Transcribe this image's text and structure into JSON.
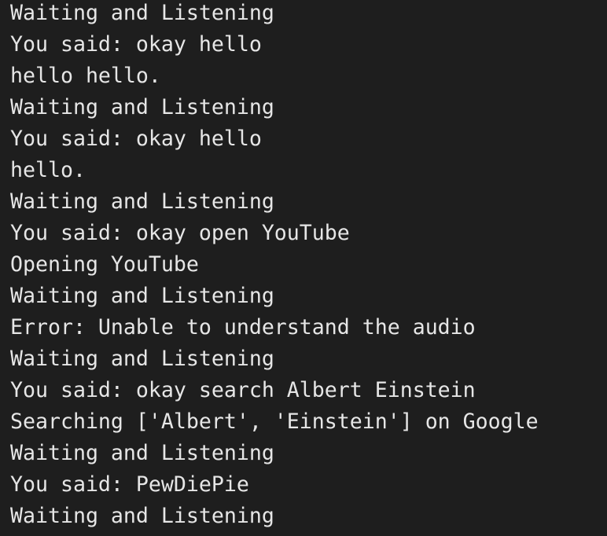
{
  "terminal": {
    "lines": [
      "Waiting and Listening",
      "You said: okay hello",
      "hello hello.",
      "Waiting and Listening",
      "You said: okay hello",
      "hello.",
      "Waiting and Listening",
      "You said: okay open YouTube",
      "Opening YouTube",
      "Waiting and Listening",
      "Error: Unable to understand the audio",
      "Waiting and Listening",
      "You said: okay search Albert Einstein",
      "Searching ['Albert', 'Einstein'] on Google",
      "Waiting and Listening",
      "You said: PewDiePie",
      "Waiting and Listening"
    ],
    "colors": {
      "background": "#1e1e1e",
      "text": "#e6e6e6"
    }
  }
}
